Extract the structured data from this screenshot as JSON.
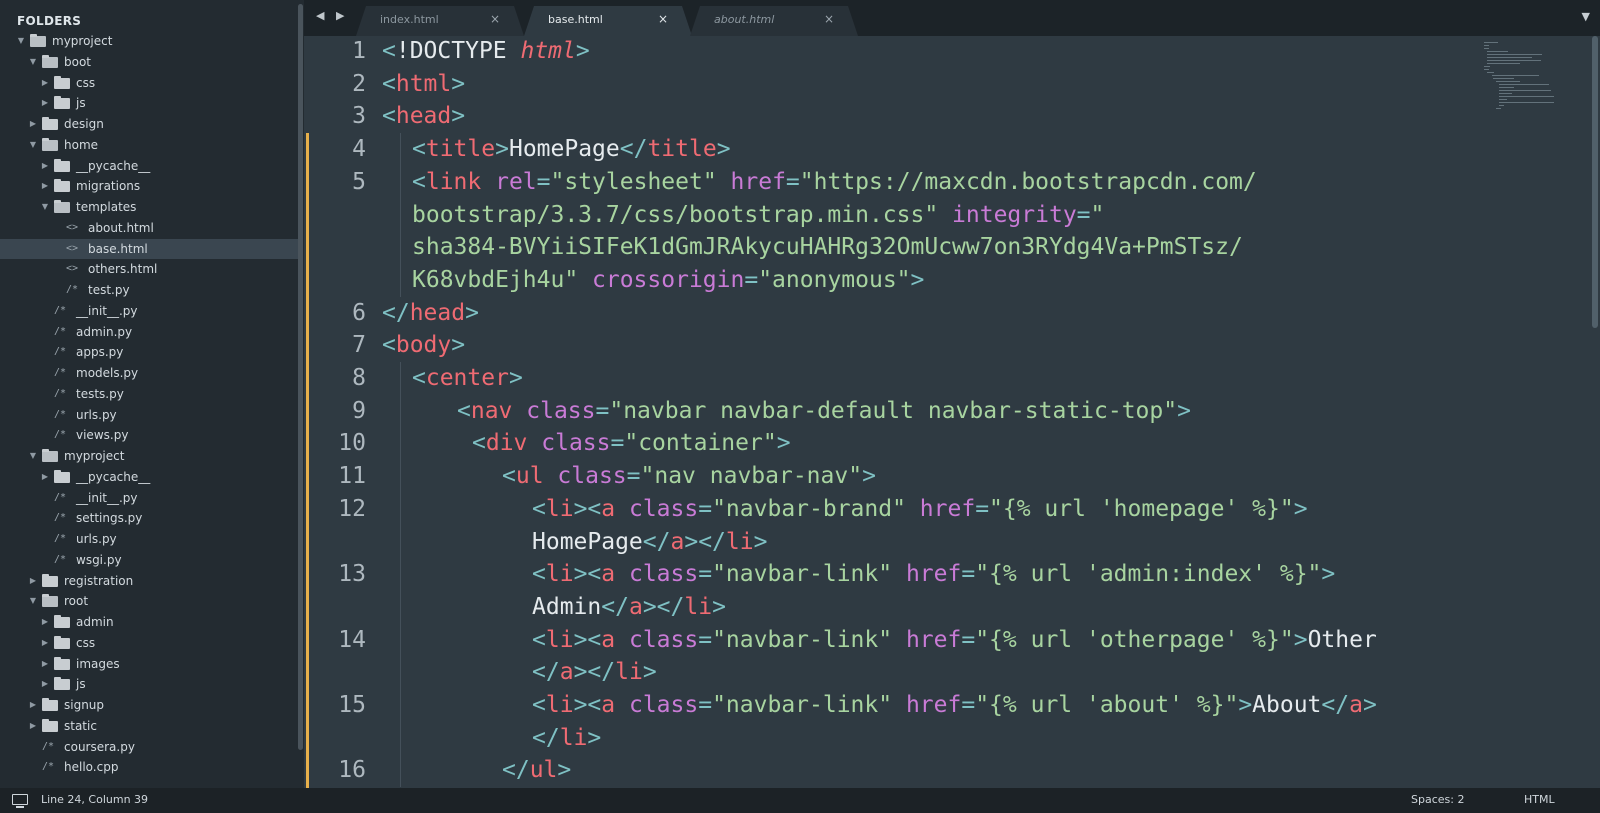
{
  "sidebar": {
    "title": "FOLDERS",
    "tree": [
      {
        "label": "myproject",
        "kind": "folder",
        "open": true,
        "depth": 0
      },
      {
        "label": "boot",
        "kind": "folder",
        "open": true,
        "depth": 1
      },
      {
        "label": "css",
        "kind": "folder",
        "open": false,
        "depth": 2
      },
      {
        "label": "js",
        "kind": "folder",
        "open": false,
        "depth": 2
      },
      {
        "label": "design",
        "kind": "folder",
        "open": false,
        "depth": 1
      },
      {
        "label": "home",
        "kind": "folder",
        "open": true,
        "depth": 1
      },
      {
        "label": "__pycache__",
        "kind": "folder",
        "open": false,
        "depth": 2
      },
      {
        "label": "migrations",
        "kind": "folder",
        "open": false,
        "depth": 2
      },
      {
        "label": "templates",
        "kind": "folder",
        "open": true,
        "depth": 2
      },
      {
        "label": "about.html",
        "kind": "html",
        "depth": 3
      },
      {
        "label": "base.html",
        "kind": "html",
        "depth": 3,
        "selected": true
      },
      {
        "label": "others.html",
        "kind": "html",
        "depth": 3
      },
      {
        "label": "test.py",
        "kind": "py",
        "depth": 3
      },
      {
        "label": "__init__.py",
        "kind": "py",
        "depth": 2
      },
      {
        "label": "admin.py",
        "kind": "py",
        "depth": 2
      },
      {
        "label": "apps.py",
        "kind": "py",
        "depth": 2
      },
      {
        "label": "models.py",
        "kind": "py",
        "depth": 2
      },
      {
        "label": "tests.py",
        "kind": "py",
        "depth": 2
      },
      {
        "label": "urls.py",
        "kind": "py",
        "depth": 2
      },
      {
        "label": "views.py",
        "kind": "py",
        "depth": 2
      },
      {
        "label": "myproject",
        "kind": "folder",
        "open": true,
        "depth": 1
      },
      {
        "label": "__pycache__",
        "kind": "folder",
        "open": false,
        "depth": 2
      },
      {
        "label": "__init__.py",
        "kind": "py",
        "depth": 2
      },
      {
        "label": "settings.py",
        "kind": "py",
        "depth": 2
      },
      {
        "label": "urls.py",
        "kind": "py",
        "depth": 2
      },
      {
        "label": "wsgi.py",
        "kind": "py",
        "depth": 2
      },
      {
        "label": "registration",
        "kind": "folder",
        "open": false,
        "depth": 1
      },
      {
        "label": "root",
        "kind": "folder",
        "open": true,
        "depth": 1
      },
      {
        "label": "admin",
        "kind": "folder",
        "open": false,
        "depth": 2
      },
      {
        "label": "css",
        "kind": "folder",
        "open": false,
        "depth": 2
      },
      {
        "label": "images",
        "kind": "folder",
        "open": false,
        "depth": 2
      },
      {
        "label": "js",
        "kind": "folder",
        "open": false,
        "depth": 2
      },
      {
        "label": "signup",
        "kind": "folder",
        "open": false,
        "depth": 1
      },
      {
        "label": "static",
        "kind": "folder",
        "open": false,
        "depth": 1
      },
      {
        "label": "coursera.py",
        "kind": "py",
        "depth": 1
      },
      {
        "label": "hello.cpp",
        "kind": "py",
        "depth": 1
      }
    ]
  },
  "tabs": {
    "nav_arrows": "◀ ▶",
    "close_glyph": "×",
    "menu_glyph": "▼",
    "items": [
      {
        "label": "index.html",
        "active": false,
        "italic": false
      },
      {
        "label": "base.html",
        "active": true,
        "italic": false
      },
      {
        "label": "about.html",
        "active": false,
        "italic": true
      }
    ]
  },
  "editor": {
    "line_numbers": [
      "1",
      "2",
      "3",
      "4",
      "5",
      "6",
      "7",
      "8",
      "9",
      "10",
      "11",
      "12",
      "13",
      "14",
      "15",
      "16"
    ],
    "lines": [
      {
        "indent": 0,
        "tokens": [
          [
            "br",
            "<"
          ],
          [
            "tx",
            "!DOCTYPE "
          ],
          [
            "kw",
            "html"
          ],
          [
            "br",
            ">"
          ]
        ]
      },
      {
        "indent": 0,
        "tokens": [
          [
            "br",
            "<"
          ],
          [
            "tg",
            "html"
          ],
          [
            "br",
            ">"
          ]
        ]
      },
      {
        "indent": 0,
        "tokens": [
          [
            "br",
            "<"
          ],
          [
            "tg",
            "head"
          ],
          [
            "br",
            ">"
          ]
        ]
      },
      {
        "indent": 2,
        "tokens": [
          [
            "br",
            "<"
          ],
          [
            "tg",
            "title"
          ],
          [
            "br",
            ">"
          ],
          [
            "tx",
            "HomePage"
          ],
          [
            "br",
            "</"
          ],
          [
            "tg",
            "title"
          ],
          [
            "br",
            ">"
          ]
        ]
      },
      {
        "indent": 2,
        "tokens": [
          [
            "br",
            "<"
          ],
          [
            "tg",
            "link "
          ],
          [
            "at",
            "rel"
          ],
          [
            "br",
            "="
          ],
          [
            "st",
            "\"stylesheet\" "
          ],
          [
            "at",
            "href"
          ],
          [
            "br",
            "="
          ],
          [
            "st",
            "\"https://maxcdn.bootstrapcdn.com/"
          ]
        ]
      },
      {
        "indent": 2,
        "tokens": [
          [
            "st",
            "bootstrap/3.3.7/css/bootstrap.min.css\" "
          ],
          [
            "at",
            "integrity"
          ],
          [
            "br",
            "="
          ],
          [
            "st",
            "\""
          ]
        ]
      },
      {
        "indent": 2,
        "tokens": [
          [
            "st",
            "sha384-BVYiiSIFeK1dGmJRAkycuHAHRg32OmUcww7on3RYdg4Va+PmSTsz/"
          ]
        ]
      },
      {
        "indent": 2,
        "tokens": [
          [
            "st",
            "K68vbdEjh4u\" "
          ],
          [
            "at",
            "crossorigin"
          ],
          [
            "br",
            "="
          ],
          [
            "st",
            "\"anonymous\""
          ],
          [
            "br",
            ">"
          ]
        ]
      },
      {
        "indent": 0,
        "tokens": [
          [
            "br",
            "</"
          ],
          [
            "tg",
            "head"
          ],
          [
            "br",
            ">"
          ]
        ]
      },
      {
        "indent": 0,
        "tokens": [
          [
            "br",
            "<"
          ],
          [
            "tg",
            "body"
          ],
          [
            "br",
            ">"
          ]
        ]
      },
      {
        "indent": 2,
        "tokens": [
          [
            "br",
            "<"
          ],
          [
            "tg",
            "center"
          ],
          [
            "br",
            ">"
          ]
        ]
      },
      {
        "indent": 5,
        "tokens": [
          [
            "br",
            "<"
          ],
          [
            "tg",
            "nav "
          ],
          [
            "at",
            "class"
          ],
          [
            "br",
            "="
          ],
          [
            "st",
            "\"navbar navbar-default navbar-static-top\""
          ],
          [
            "br",
            ">"
          ]
        ]
      },
      {
        "indent": 6,
        "tokens": [
          [
            "br",
            "<"
          ],
          [
            "tg",
            "div "
          ],
          [
            "at",
            "class"
          ],
          [
            "br",
            "="
          ],
          [
            "st",
            "\"container\""
          ],
          [
            "br",
            ">"
          ]
        ]
      },
      {
        "indent": 8,
        "tokens": [
          [
            "br",
            "<"
          ],
          [
            "tg",
            "ul "
          ],
          [
            "at",
            "class"
          ],
          [
            "br",
            "="
          ],
          [
            "st",
            "\"nav navbar-nav\""
          ],
          [
            "br",
            ">"
          ]
        ]
      },
      {
        "indent": 10,
        "tokens": [
          [
            "br",
            "<"
          ],
          [
            "tg",
            "li"
          ],
          [
            "br",
            "><"
          ],
          [
            "tg",
            "a "
          ],
          [
            "at",
            "class"
          ],
          [
            "br",
            "="
          ],
          [
            "st",
            "\"navbar-brand\" "
          ],
          [
            "at",
            "href"
          ],
          [
            "br",
            "="
          ],
          [
            "st",
            "\"{% url 'homepage' %}\""
          ],
          [
            "br",
            ">"
          ]
        ]
      },
      {
        "indent": 10,
        "tokens": [
          [
            "tx",
            "HomePage"
          ],
          [
            "br",
            "</"
          ],
          [
            "tg",
            "a"
          ],
          [
            "br",
            "></"
          ],
          [
            "tg",
            "li"
          ],
          [
            "br",
            ">"
          ]
        ]
      },
      {
        "indent": 10,
        "tokens": [
          [
            "br",
            "<"
          ],
          [
            "tg",
            "li"
          ],
          [
            "br",
            "><"
          ],
          [
            "tg",
            "a "
          ],
          [
            "at",
            "class"
          ],
          [
            "br",
            "="
          ],
          [
            "st",
            "\"navbar-link\" "
          ],
          [
            "at",
            "href"
          ],
          [
            "br",
            "="
          ],
          [
            "st",
            "\"{% url 'admin:index' %}\""
          ],
          [
            "br",
            ">"
          ]
        ]
      },
      {
        "indent": 10,
        "tokens": [
          [
            "tx",
            "Admin"
          ],
          [
            "br",
            "</"
          ],
          [
            "tg",
            "a"
          ],
          [
            "br",
            "></"
          ],
          [
            "tg",
            "li"
          ],
          [
            "br",
            ">"
          ]
        ]
      },
      {
        "indent": 10,
        "tokens": [
          [
            "br",
            "<"
          ],
          [
            "tg",
            "li"
          ],
          [
            "br",
            "><"
          ],
          [
            "tg",
            "a "
          ],
          [
            "at",
            "class"
          ],
          [
            "br",
            "="
          ],
          [
            "st",
            "\"navbar-link\" "
          ],
          [
            "at",
            "href"
          ],
          [
            "br",
            "="
          ],
          [
            "st",
            "\"{% url 'otherpage' %}\""
          ],
          [
            "br",
            ">"
          ],
          [
            "tx",
            "Other"
          ]
        ]
      },
      {
        "indent": 10,
        "tokens": [
          [
            "br",
            "</"
          ],
          [
            "tg",
            "a"
          ],
          [
            "br",
            "></"
          ],
          [
            "tg",
            "li"
          ],
          [
            "br",
            ">"
          ]
        ]
      },
      {
        "indent": 10,
        "tokens": [
          [
            "br",
            "<"
          ],
          [
            "tg",
            "li"
          ],
          [
            "br",
            "><"
          ],
          [
            "tg",
            "a "
          ],
          [
            "at",
            "class"
          ],
          [
            "br",
            "="
          ],
          [
            "st",
            "\"navbar-link\" "
          ],
          [
            "at",
            "href"
          ],
          [
            "br",
            "="
          ],
          [
            "st",
            "\"{% url 'about' %}\""
          ],
          [
            "br",
            ">"
          ],
          [
            "tx",
            "About"
          ],
          [
            "br",
            "</"
          ],
          [
            "tg",
            "a"
          ],
          [
            "br",
            ">"
          ]
        ]
      },
      {
        "indent": 10,
        "tokens": [
          [
            "br",
            "</"
          ],
          [
            "tg",
            "li"
          ],
          [
            "br",
            ">"
          ]
        ]
      },
      {
        "indent": 8,
        "tokens": [
          [
            "br",
            "</"
          ],
          [
            "tg",
            "ul"
          ],
          [
            "br",
            ">"
          ]
        ]
      }
    ]
  },
  "status": {
    "position": "Line 24, Column 39",
    "spaces": "Spaces: 2",
    "syntax": "HTML"
  }
}
